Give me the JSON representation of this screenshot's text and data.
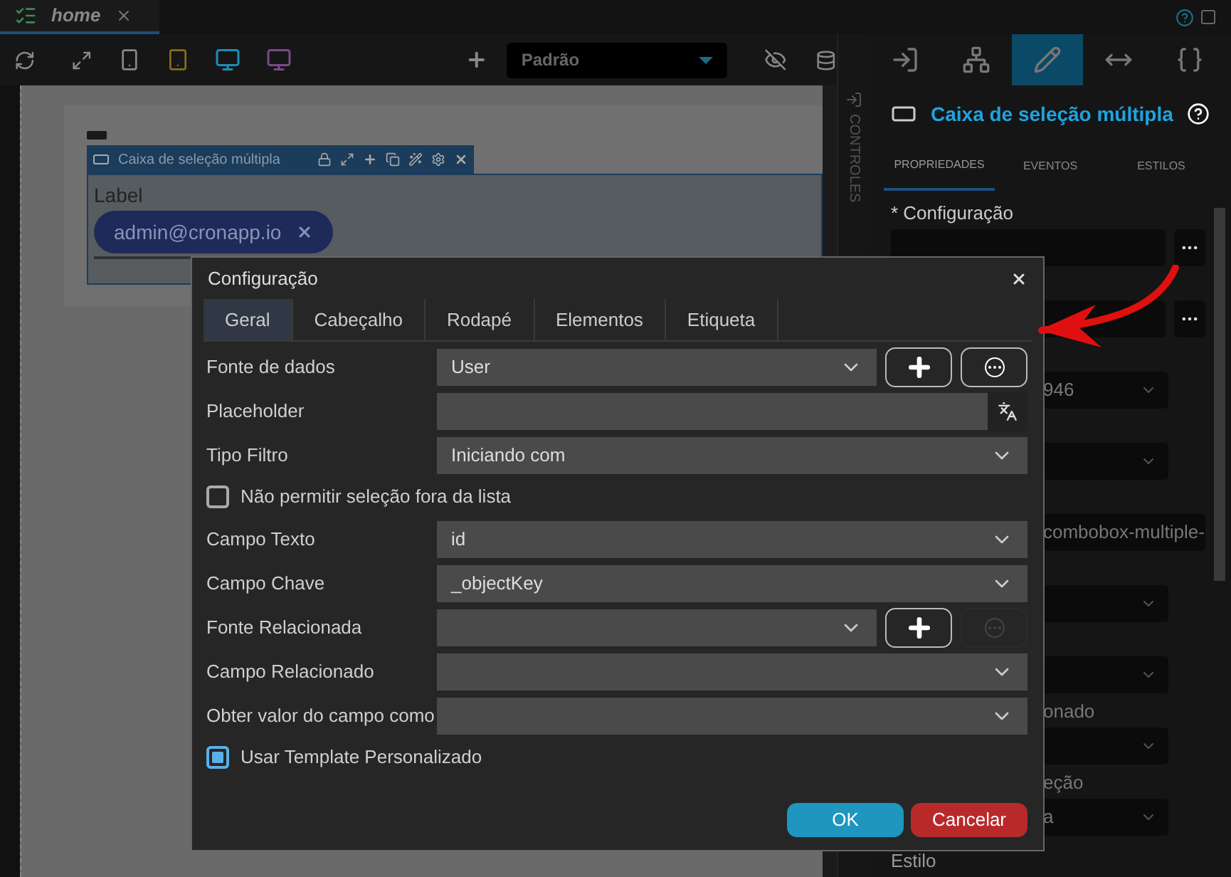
{
  "file_tab": {
    "label": "home",
    "selected": true
  },
  "toolbar": {
    "devices": [
      {
        "kind": "mobile",
        "selected": false
      },
      {
        "kind": "tablet",
        "selected": false
      },
      {
        "kind": "desktop",
        "selected": true
      },
      {
        "kind": "monitor",
        "selected": false
      }
    ],
    "theme_select": {
      "value": "Padrão"
    }
  },
  "canvas": {
    "component_header": "Caixa de seleção múltipla",
    "field_label": "Label",
    "chips": [
      "admin@cronapp.io"
    ]
  },
  "side_strip": {
    "label": "CONTROLES"
  },
  "panel": {
    "tabs": [
      {
        "kind": "enter",
        "selected": false
      },
      {
        "kind": "tree",
        "selected": false
      },
      {
        "kind": "pencil",
        "selected": true
      },
      {
        "kind": "resize",
        "selected": false
      },
      {
        "kind": "code",
        "selected": false
      }
    ],
    "title": "Caixa de seleção múltipla",
    "subtabs": [
      {
        "label": "PROPRIEDADES",
        "selected": true
      },
      {
        "label": "EVENTOS",
        "selected": false
      },
      {
        "label": "ESTILOS",
        "selected": false
      }
    ],
    "properties": [
      {
        "kind": "dots",
        "label": "* Configuração"
      },
      {
        "kind": "dots"
      },
      {
        "kind": "select",
        "value": "946"
      },
      {
        "kind": "select"
      },
      {
        "kind": "input",
        "value": "combobox-multiple-"
      },
      {
        "kind": "select"
      },
      {
        "kind": "select"
      },
      {
        "kind": "select",
        "label": "onado"
      },
      {
        "kind": "select",
        "label": "eção",
        "value": "a"
      },
      {
        "kind": "heading",
        "label": "Estilo"
      }
    ]
  },
  "dialog": {
    "title": "Configuração",
    "tabs": [
      {
        "label": "Geral",
        "selected": true
      },
      {
        "label": "Cabeçalho",
        "selected": false
      },
      {
        "label": "Rodapé",
        "selected": false
      },
      {
        "label": "Elementos",
        "selected": false
      },
      {
        "label": "Etiqueta",
        "selected": false
      }
    ],
    "rows": [
      {
        "kind": "select",
        "label": "Fonte de dados",
        "value": "User",
        "buttons": [
          {
            "kind": "add",
            "disabled": false
          },
          {
            "kind": "more",
            "disabled": false
          }
        ]
      },
      {
        "kind": "input",
        "label": "Placeholder"
      },
      {
        "kind": "select",
        "label": "Tipo Filtro",
        "value": "Iniciando com"
      },
      {
        "kind": "checkbox",
        "label": "Não permitir seleção fora da lista",
        "checked": false
      },
      {
        "kind": "select",
        "label": "Campo Texto",
        "value": "id"
      },
      {
        "kind": "select",
        "label": "Campo Chave",
        "value": "_objectKey"
      },
      {
        "kind": "select",
        "label": "Fonte Relacionada",
        "buttons": [
          {
            "kind": "add",
            "disabled": false
          },
          {
            "kind": "more",
            "disabled": true
          }
        ]
      },
      {
        "kind": "select",
        "label": "Campo Relacionado"
      },
      {
        "kind": "select",
        "label": "Obter valor do campo como"
      },
      {
        "kind": "checkbox",
        "label": "Usar Template Personalizado",
        "checked": true
      }
    ],
    "buttons": [
      {
        "kind": "ok",
        "label": "OK"
      },
      {
        "kind": "cancel",
        "label": "Cancelar"
      }
    ]
  }
}
